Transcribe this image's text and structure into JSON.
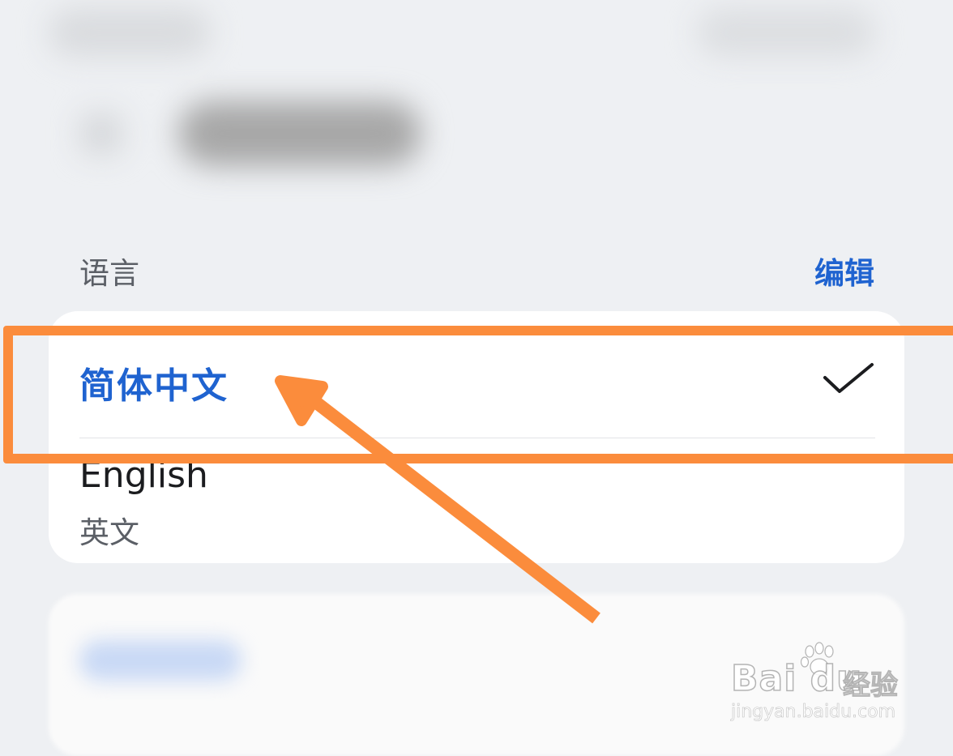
{
  "section": {
    "label": "语言",
    "edit_label": "编辑"
  },
  "languages": [
    {
      "label": "简体中文",
      "sublabel": "",
      "selected": true
    },
    {
      "label": "English",
      "sublabel": "英文",
      "selected": false
    }
  ],
  "colors": {
    "accent": "#1f63d0",
    "annotation": "#fb8c3c",
    "background": "#eef0f3",
    "card": "#ffffff"
  },
  "icons": {
    "selected_marker": "checkmark-icon",
    "annotation_arrow": "arrow-icon",
    "watermark_logo": "paw-icon"
  },
  "watermark": {
    "brand": "Bai du",
    "suffix": "经验",
    "url": "jingyan.baidu.com"
  }
}
